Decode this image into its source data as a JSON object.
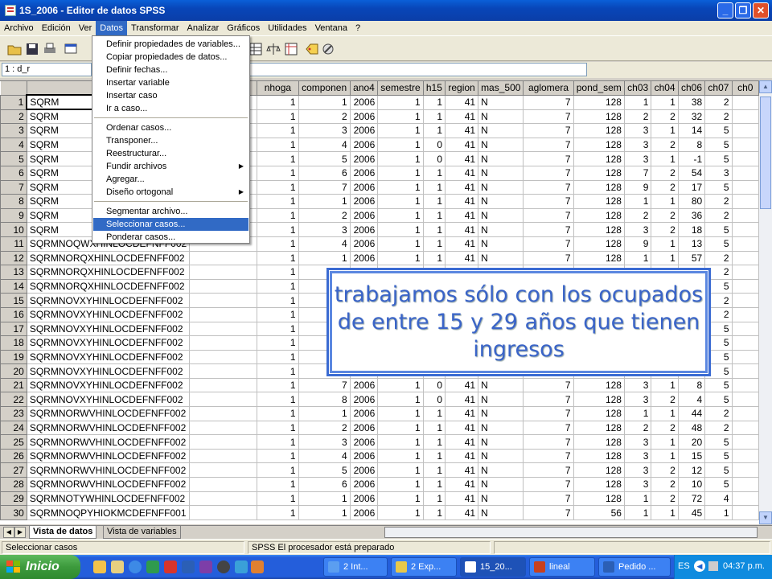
{
  "window": {
    "title": "1S_2006 - Editor de datos SPSS"
  },
  "menu": [
    "Archivo",
    "Edición",
    "Ver",
    "Datos",
    "Transformar",
    "Analizar",
    "Gráficos",
    "Utilidades",
    "Ventana",
    "?"
  ],
  "cell_ref": "1 : d_r",
  "datos_menu": {
    "items": [
      {
        "label": "Definir propiedades de variables..."
      },
      {
        "label": "Copiar propiedades de datos..."
      },
      {
        "label": "Definir fechas..."
      },
      {
        "label": "Insertar variable"
      },
      {
        "label": "Insertar caso"
      },
      {
        "label": "Ir a caso..."
      },
      {
        "label": "Ordenar casos..."
      },
      {
        "label": "Transponer..."
      },
      {
        "label": "Reestructurar..."
      },
      {
        "label": "Fundir archivos"
      },
      {
        "label": "Agregar..."
      },
      {
        "label": "Diseño ortogonal"
      },
      {
        "label": "Segmentar archivo..."
      },
      {
        "label": "Seleccionar casos..."
      },
      {
        "label": "Ponderar casos..."
      }
    ]
  },
  "columns": [
    "d_r",
    "",
    "nhoga",
    "componen",
    "ano4",
    "semestre",
    "h15",
    "region",
    "mas_500",
    "aglomera",
    "pond_sem",
    "ch03",
    "ch04",
    "ch06",
    "ch07",
    "ch0"
  ],
  "rows": [
    [
      "1",
      "SQRM",
      "",
      "1",
      "1",
      "2006",
      "1",
      "1",
      "41",
      "N",
      "7",
      "128",
      "1",
      "1",
      "38",
      "2"
    ],
    [
      "2",
      "SQRM",
      "",
      "1",
      "2",
      "2006",
      "1",
      "1",
      "41",
      "N",
      "7",
      "128",
      "2",
      "2",
      "32",
      "2"
    ],
    [
      "3",
      "SQRM",
      "",
      "1",
      "3",
      "2006",
      "1",
      "1",
      "41",
      "N",
      "7",
      "128",
      "3",
      "1",
      "14",
      "5"
    ],
    [
      "4",
      "SQRM",
      "",
      "1",
      "4",
      "2006",
      "1",
      "0",
      "41",
      "N",
      "7",
      "128",
      "3",
      "2",
      "8",
      "5"
    ],
    [
      "5",
      "SQRM",
      "",
      "1",
      "5",
      "2006",
      "1",
      "0",
      "41",
      "N",
      "7",
      "128",
      "3",
      "1",
      "-1",
      "5"
    ],
    [
      "6",
      "SQRM",
      "",
      "1",
      "6",
      "2006",
      "1",
      "1",
      "41",
      "N",
      "7",
      "128",
      "7",
      "2",
      "54",
      "3"
    ],
    [
      "7",
      "SQRM",
      "",
      "1",
      "7",
      "2006",
      "1",
      "1",
      "41",
      "N",
      "7",
      "128",
      "9",
      "2",
      "17",
      "5"
    ],
    [
      "8",
      "SQRM",
      "",
      "1",
      "1",
      "2006",
      "1",
      "1",
      "41",
      "N",
      "7",
      "128",
      "1",
      "1",
      "80",
      "2"
    ],
    [
      "9",
      "SQRM",
      "",
      "1",
      "2",
      "2006",
      "1",
      "1",
      "41",
      "N",
      "7",
      "128",
      "2",
      "2",
      "36",
      "2"
    ],
    [
      "10",
      "SQRM",
      "",
      "1",
      "3",
      "2006",
      "1",
      "1",
      "41",
      "N",
      "7",
      "128",
      "3",
      "2",
      "18",
      "5"
    ],
    [
      "11",
      "SQRMNOQWXHINLOCDEFNFF002",
      "",
      "1",
      "4",
      "2006",
      "1",
      "1",
      "41",
      "N",
      "7",
      "128",
      "9",
      "1",
      "13",
      "5"
    ],
    [
      "12",
      "SQRMNORQXHINLOCDEFNFF002",
      "",
      "1",
      "1",
      "2006",
      "1",
      "1",
      "41",
      "N",
      "7",
      "128",
      "1",
      "1",
      "57",
      "2"
    ],
    [
      "13",
      "SQRMNORQXHINLOCDEFNFF002",
      "",
      "1",
      "2",
      "",
      "",
      "",
      "",
      "",
      "",
      "",
      "",
      "",
      "",
      "2"
    ],
    [
      "14",
      "SQRMNORQXHINLOCDEFNFF002",
      "",
      "1",
      "3",
      "",
      "",
      "",
      "",
      "",
      "",
      "",
      "",
      "",
      "",
      "5"
    ],
    [
      "15",
      "SQRMNOVXYHINLOCDEFNFF002",
      "",
      "1",
      "1",
      "",
      "",
      "",
      "",
      "",
      "",
      "",
      "",
      "",
      "",
      "2"
    ],
    [
      "16",
      "SQRMNOVXYHINLOCDEFNFF002",
      "",
      "1",
      "2",
      "",
      "",
      "",
      "",
      "",
      "",
      "",
      "",
      "",
      "",
      "2"
    ],
    [
      "17",
      "SQRMNOVXYHINLOCDEFNFF002",
      "",
      "1",
      "3",
      "",
      "",
      "",
      "",
      "",
      "",
      "",
      "",
      "",
      "",
      "5"
    ],
    [
      "18",
      "SQRMNOVXYHINLOCDEFNFF002",
      "",
      "1",
      "4",
      "",
      "",
      "",
      "",
      "",
      "",
      "",
      "",
      "",
      "",
      "5"
    ],
    [
      "19",
      "SQRMNOVXYHINLOCDEFNFF002",
      "",
      "1",
      "5",
      "",
      "",
      "",
      "",
      "",
      "",
      "",
      "",
      "",
      "",
      "5"
    ],
    [
      "20",
      "SQRMNOVXYHINLOCDEFNFF002",
      "",
      "1",
      "6",
      "2006",
      "1",
      "0",
      "41",
      "N",
      "7",
      "128",
      "3",
      "2",
      "9",
      "5"
    ],
    [
      "21",
      "SQRMNOVXYHINLOCDEFNFF002",
      "",
      "1",
      "7",
      "2006",
      "1",
      "0",
      "41",
      "N",
      "7",
      "128",
      "3",
      "1",
      "8",
      "5"
    ],
    [
      "22",
      "SQRMNOVXYHINLOCDEFNFF002",
      "",
      "1",
      "8",
      "2006",
      "1",
      "0",
      "41",
      "N",
      "7",
      "128",
      "3",
      "2",
      "4",
      "5"
    ],
    [
      "23",
      "SQRMNORWVHINLOCDEFNFF002",
      "",
      "1",
      "1",
      "2006",
      "1",
      "1",
      "41",
      "N",
      "7",
      "128",
      "1",
      "1",
      "44",
      "2"
    ],
    [
      "24",
      "SQRMNORWVHINLOCDEFNFF002",
      "",
      "1",
      "2",
      "2006",
      "1",
      "1",
      "41",
      "N",
      "7",
      "128",
      "2",
      "2",
      "48",
      "2"
    ],
    [
      "25",
      "SQRMNORWVHINLOCDEFNFF002",
      "",
      "1",
      "3",
      "2006",
      "1",
      "1",
      "41",
      "N",
      "7",
      "128",
      "3",
      "1",
      "20",
      "5"
    ],
    [
      "26",
      "SQRMNORWVHINLOCDEFNFF002",
      "",
      "1",
      "4",
      "2006",
      "1",
      "1",
      "41",
      "N",
      "7",
      "128",
      "3",
      "1",
      "15",
      "5"
    ],
    [
      "27",
      "SQRMNORWVHINLOCDEFNFF002",
      "",
      "1",
      "5",
      "2006",
      "1",
      "1",
      "41",
      "N",
      "7",
      "128",
      "3",
      "2",
      "12",
      "5"
    ],
    [
      "28",
      "SQRMNORWVHINLOCDEFNFF002",
      "",
      "1",
      "6",
      "2006",
      "1",
      "1",
      "41",
      "N",
      "7",
      "128",
      "3",
      "2",
      "10",
      "5"
    ],
    [
      "29",
      "SQRMNOTYWHINLOCDEFNFF002",
      "",
      "1",
      "1",
      "2006",
      "1",
      "1",
      "41",
      "N",
      "7",
      "128",
      "1",
      "2",
      "72",
      "4"
    ],
    [
      "30",
      "SQRMNOQPYHIOKMCDEFNFF001",
      "",
      "1",
      "1",
      "2006",
      "1",
      "1",
      "41",
      "N",
      "7",
      "56",
      "1",
      "1",
      "45",
      "1"
    ]
  ],
  "tabs": [
    "Vista de datos",
    "Vista de variables"
  ],
  "status": {
    "left": "Seleccionar casos",
    "right": "SPSS El procesador  está preparado"
  },
  "callout": {
    "text": "trabajamos sólo con los ocupados de entre 15 y 29 años que tienen ingresos"
  },
  "taskbar": {
    "start": "Inicio",
    "tasks": [
      "2 Int...",
      "2 Exp...",
      "15_20...",
      "lineal",
      "Pedido ..."
    ],
    "lang": "ES",
    "clock": "04:37 p.m."
  }
}
